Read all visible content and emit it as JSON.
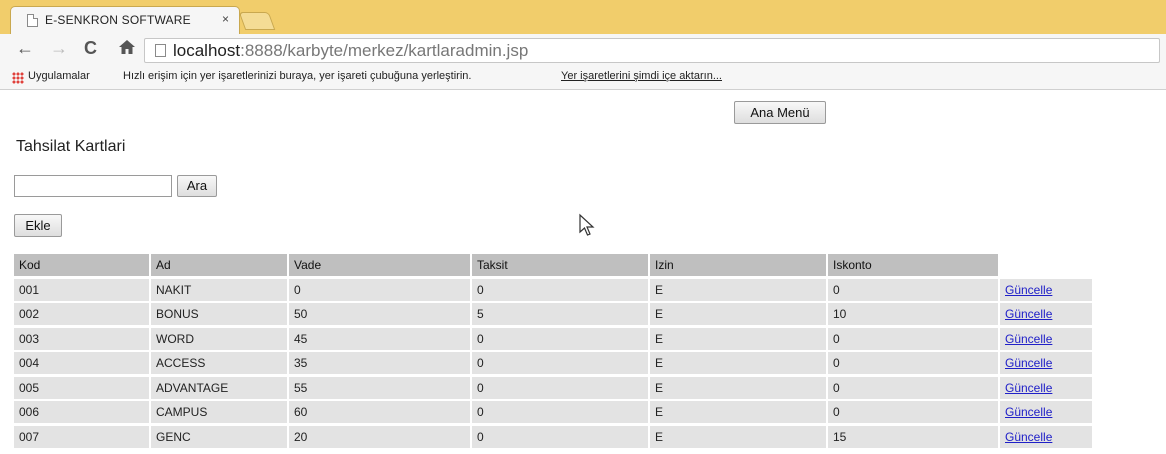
{
  "browser": {
    "tab_title": "E-SENKRON SOFTWARE",
    "tab_close": "×",
    "url_host": "localhost",
    "url_rest": ":8888/karbyte/merkez/kartlaradmin.jsp",
    "bookmarks": {
      "apps_label": "Uygulamalar",
      "hint": "Hızlı erişim için yer işaretlerinizi buraya, yer işareti çubuğuna yerleştirin.",
      "import_link": "Yer işaretlerini şimdi içe aktarın..."
    }
  },
  "page": {
    "menu_button": "Ana Menü",
    "title": "Tahsilat Kartlari",
    "search": {
      "value": "",
      "button": "Ara"
    },
    "add_button": "Ekle"
  },
  "table": {
    "columns": [
      "Kod",
      "Ad",
      "Vade",
      "Taksit",
      "Izin",
      "Iskonto"
    ],
    "action_label": "Güncelle",
    "rows": [
      [
        "001",
        "NAKIT",
        "0",
        "0",
        "E",
        "0"
      ],
      [
        "002",
        "BONUS",
        "50",
        "5",
        "E",
        "10"
      ],
      [
        "003",
        "WORD",
        "45",
        "0",
        "E",
        "0"
      ],
      [
        "004",
        "ACCESS",
        "35",
        "0",
        "E",
        "0"
      ],
      [
        "005",
        "ADVANTAGE",
        "55",
        "0",
        "E",
        "0"
      ],
      [
        "006",
        "CAMPUS",
        "60",
        "0",
        "E",
        "0"
      ],
      [
        "007",
        "GENC",
        "20",
        "0",
        "E",
        "15"
      ]
    ]
  }
}
